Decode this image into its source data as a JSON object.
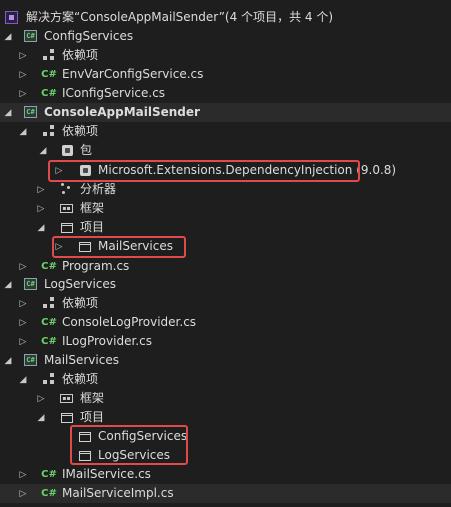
{
  "solution": {
    "label": "解决方案“ConsoleAppMailSender”(4 个项目，共 4 个)"
  },
  "icons": {
    "solution": "solution-icon",
    "project": "csharp-project-icon",
    "cs_file": "csharp-file-icon",
    "dependencies": "dependencies-icon",
    "packages": "package-icon",
    "analyzers": "analyzer-icon",
    "frameworks": "framework-icon",
    "folder": "folder-icon"
  },
  "colors": {
    "highlight_border": "#e04a4a",
    "background": "#1e1e1e",
    "csharp_green": "#6bd36b"
  },
  "tree": {
    "config_services": {
      "label": "ConfigServices",
      "deps": "依赖项",
      "file1": "EnvVarConfigService.cs",
      "file2": "IConfigService.cs"
    },
    "console_app": {
      "label": "ConsoleAppMailSender",
      "deps": "依赖项",
      "packages": "包",
      "package_item": "Microsoft.Extensions.DependencyInjection (9.0.8)",
      "analyzers": "分析器",
      "frameworks": "框架",
      "projects": "项目",
      "project_ref": "MailServices",
      "file1": "Program.cs"
    },
    "log_services": {
      "label": "LogServices",
      "deps": "依赖项",
      "file1": "ConsoleLogProvider.cs",
      "file2": "ILogProvider.cs"
    },
    "mail_services": {
      "label": "MailServices",
      "deps": "依赖项",
      "frameworks": "框架",
      "projects": "项目",
      "project_ref1": "ConfigServices",
      "project_ref2": "LogServices",
      "file1": "IMailService.cs",
      "file2": "MailServiceImpl.cs"
    }
  }
}
